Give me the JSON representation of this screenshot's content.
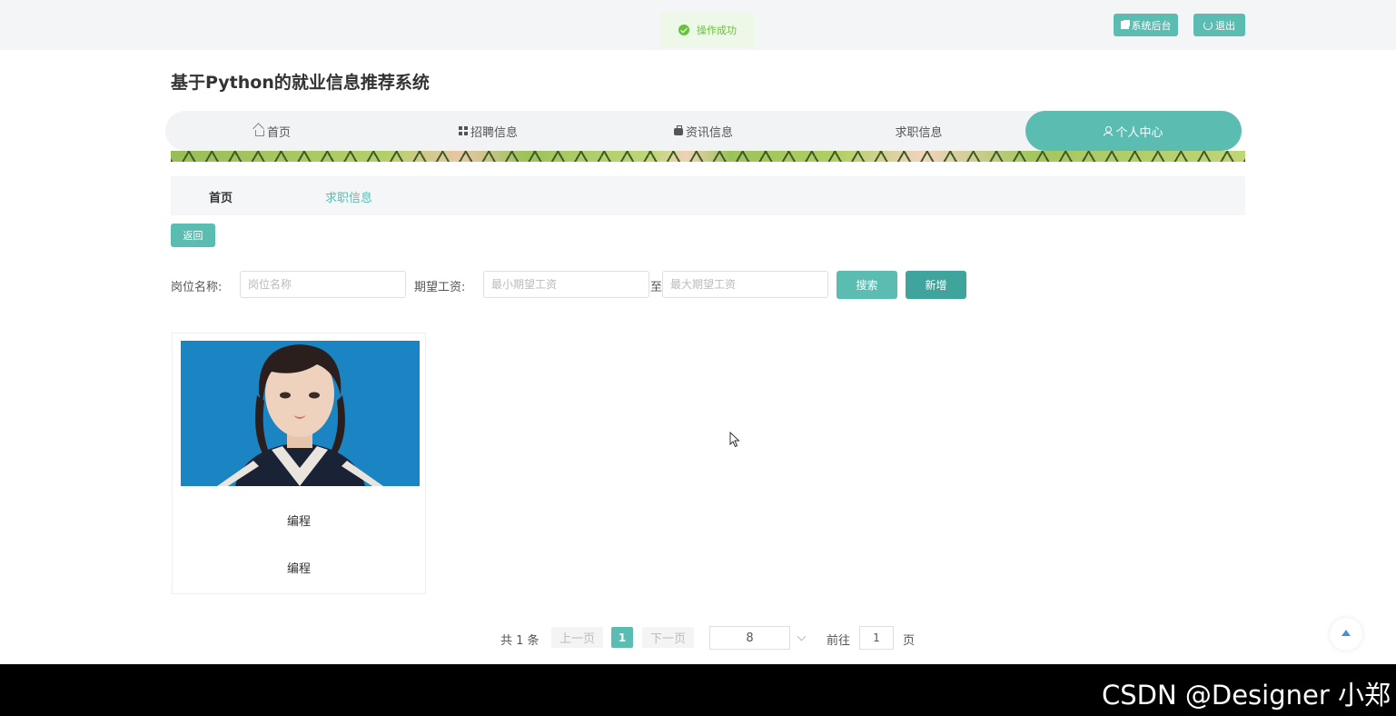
{
  "toast": {
    "text": "操作成功",
    "color": "#67c23a"
  },
  "top_buttons": {
    "system": "系统后台",
    "exit": "退出"
  },
  "site": {
    "title": "基于Python的就业信息推荐系统"
  },
  "nav": {
    "items": [
      {
        "label": "首页",
        "icon": "home-icon"
      },
      {
        "label": "招聘信息",
        "icon": "grid-icon"
      },
      {
        "label": "资讯信息",
        "icon": "briefcase-icon"
      },
      {
        "label": "求职信息",
        "icon": ""
      },
      {
        "label": "个人中心",
        "icon": "user-icon"
      }
    ],
    "active": "个人中心"
  },
  "breadcrumb": {
    "home": "首页",
    "current": "求职信息"
  },
  "actions": {
    "back": "返回"
  },
  "filters": {
    "position_label": "岗位名称:",
    "position_placeholder": "岗位名称",
    "salary_label": "期望工资:",
    "salary_min_placeholder": "最小期望工资",
    "salary_sep": "至",
    "salary_max_placeholder": "最大期望工资",
    "search_btn": "搜索",
    "add_btn": "新增"
  },
  "cards": [
    {
      "title": "编程",
      "subtitle": "编程"
    }
  ],
  "pagination": {
    "total": "共 1 条",
    "prev": "上一页",
    "current": "1",
    "next": "下一页",
    "page_size": "8",
    "goto": "前往",
    "goto_value": "1",
    "page": "页"
  },
  "watermark": "CSDN @Designer 小郑",
  "colors": {
    "accent": "#5bbcb2",
    "accent_dark": "#3fa49b"
  }
}
